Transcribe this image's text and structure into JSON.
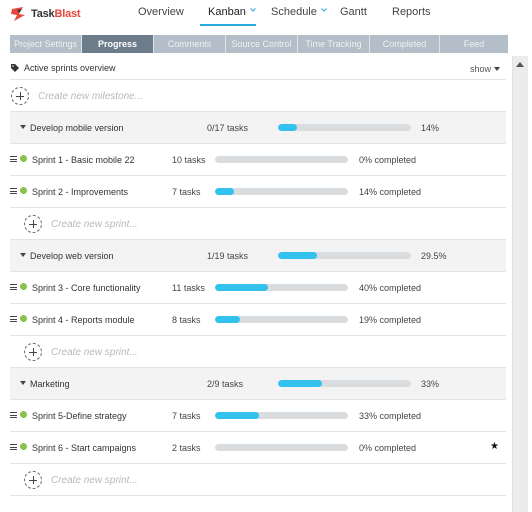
{
  "app": {
    "logo_text_task": "Task",
    "logo_text_blast": "Blast",
    "accent_color": "#29a9e0",
    "progress_color": "#33c2ee",
    "status_dot_color": "#8ac04b"
  },
  "nav": {
    "items": [
      {
        "label": "Overview"
      },
      {
        "label": "Kanban"
      },
      {
        "label": "Schedule"
      },
      {
        "label": "Gantt"
      },
      {
        "label": "Reports"
      }
    ],
    "active": "Kanban"
  },
  "tabs": [
    {
      "label": "Project Settings"
    },
    {
      "label": "Progress"
    },
    {
      "label": "Comments"
    },
    {
      "label": "Source Control"
    },
    {
      "label": "Time Tracking"
    },
    {
      "label": "Completed"
    },
    {
      "label": "Feed"
    }
  ],
  "active_tab": "Progress",
  "overview": {
    "title": "Active sprints overview",
    "show_label": "show"
  },
  "new_milestone_placeholder": "Create new milestone...",
  "new_sprint_placeholder": "Create new sprint...",
  "groups": [
    {
      "name": "Develop mobile version",
      "tasks": "0/17 tasks",
      "progress": 0.14,
      "pct": "14%",
      "sprints": [
        {
          "name": "Sprint 1 - Basic mobile 22",
          "tasks": "10 tasks",
          "progress": 0.0,
          "pct": "0% completed",
          "starred": false
        },
        {
          "name": "Sprint 2 - Improvements",
          "tasks": "7 tasks",
          "progress": 0.14,
          "pct": "14% completed",
          "starred": false
        }
      ]
    },
    {
      "name": "Develop web version",
      "tasks": "1/19 tasks",
      "progress": 0.295,
      "pct": "29.5%",
      "sprints": [
        {
          "name": "Sprint 3 - Core functionality",
          "tasks": "11 tasks",
          "progress": 0.4,
          "pct": "40% completed",
          "starred": false
        },
        {
          "name": "Sprint 4 - Reports module",
          "tasks": "8 tasks",
          "progress": 0.19,
          "pct": "19% completed",
          "starred": false
        }
      ]
    },
    {
      "name": "Marketing",
      "tasks": "2/9 tasks",
      "progress": 0.33,
      "pct": "33%",
      "sprints": [
        {
          "name": "Sprint 5-Define strategy",
          "tasks": "7 tasks",
          "progress": 0.33,
          "pct": "33% completed",
          "starred": false
        },
        {
          "name": "Sprint 6 - Start campaigns",
          "tasks": "2 tasks",
          "progress": 0.0,
          "pct": "0% completed",
          "starred": true
        }
      ]
    }
  ]
}
